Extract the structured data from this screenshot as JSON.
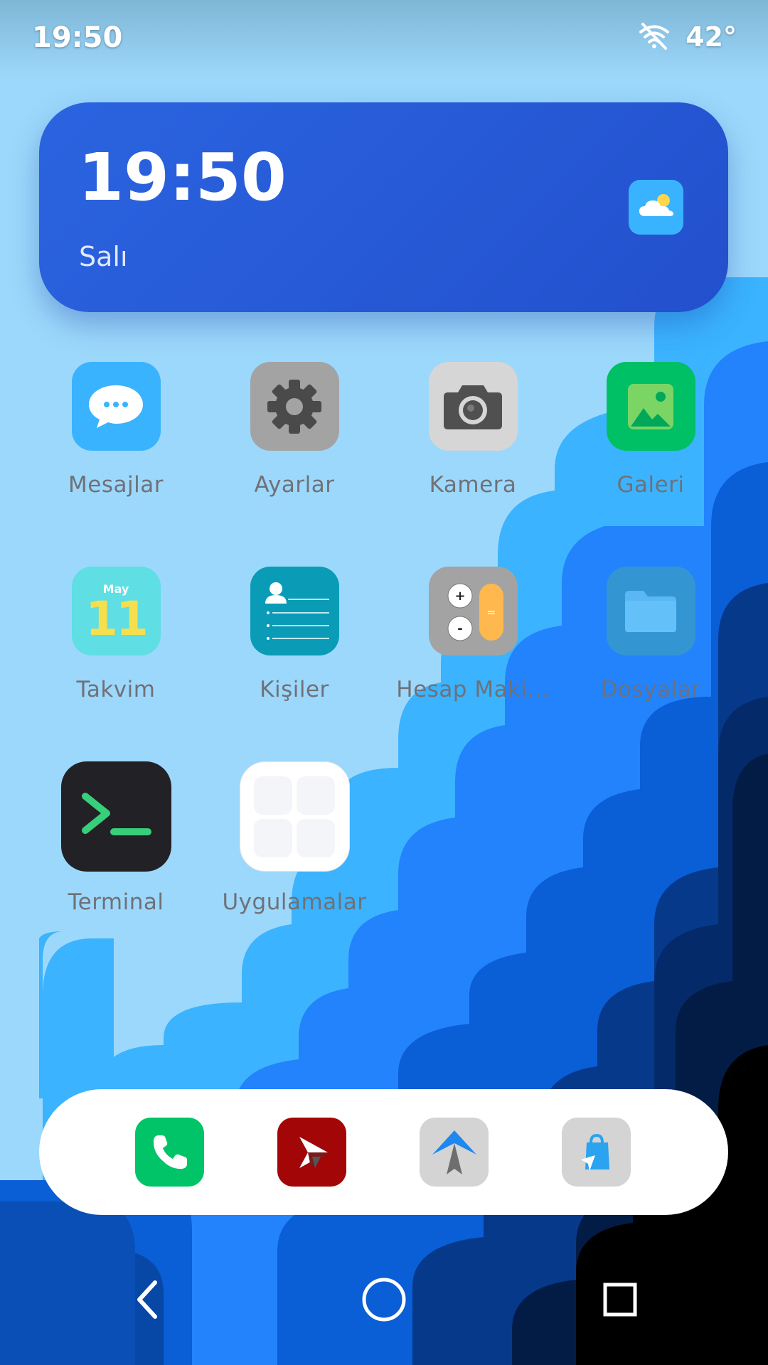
{
  "status": {
    "time": "19:50",
    "temperature": "42°",
    "wifi_icon": "wifi-off-icon"
  },
  "widget": {
    "time": "19:50",
    "day": "Salı",
    "weather_icon": "partly-cloudy-icon"
  },
  "apps": [
    {
      "label": "Mesajlar",
      "icon": "messages-icon"
    },
    {
      "label": "Ayarlar",
      "icon": "settings-gear-icon"
    },
    {
      "label": "Kamera",
      "icon": "camera-icon"
    },
    {
      "label": "Galeri",
      "icon": "gallery-icon"
    },
    {
      "label": "Takvim",
      "icon": "calendar-icon",
      "calendar_month": "May",
      "calendar_day": "11"
    },
    {
      "label": "Kişiler",
      "icon": "contacts-icon"
    },
    {
      "label": "Hesap Maki...",
      "icon": "calculator-icon"
    },
    {
      "label": "Dosyalar",
      "icon": "folder-icon"
    },
    {
      "label": "Terminal",
      "icon": "terminal-icon"
    },
    {
      "label": "Uygulamalar",
      "icon": "app-drawer-icon"
    }
  ],
  "dock": [
    {
      "icon": "phone-icon"
    },
    {
      "icon": "red-arrow-app-icon"
    },
    {
      "icon": "navigation-app-icon"
    },
    {
      "icon": "store-bag-icon"
    }
  ],
  "navigation": {
    "back": "back-icon",
    "home": "home-icon",
    "recents": "recents-icon"
  },
  "colors": {
    "widget": "#2b5ed9",
    "accent_blue": "#3ab3ff",
    "label": "#6f7178",
    "phone_green": "#00c467",
    "terminal_bg": "#222126"
  }
}
